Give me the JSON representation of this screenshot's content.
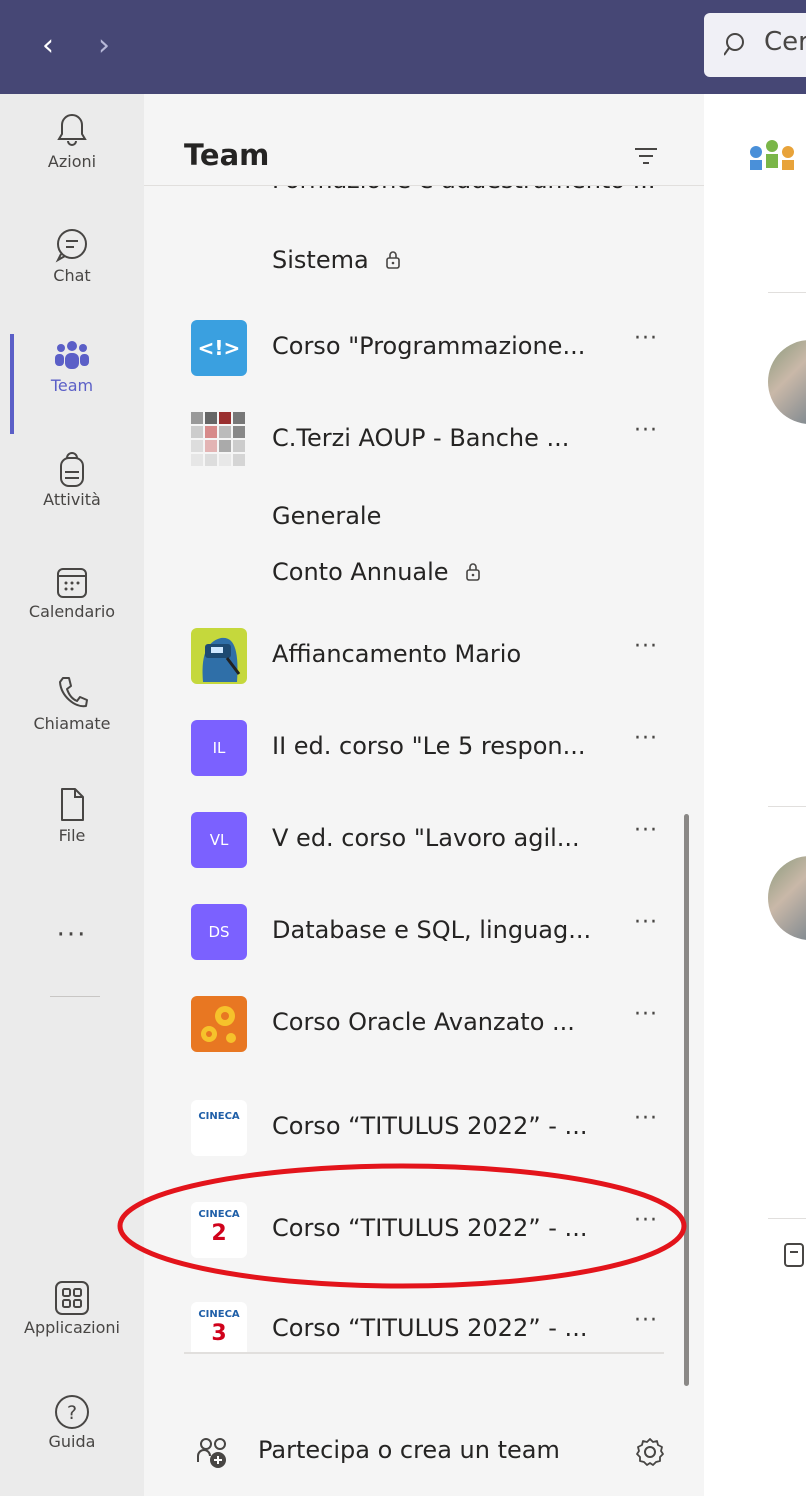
{
  "titlebar": {
    "back_icon": "chevron-left-icon",
    "forward_icon": "chevron-right-icon",
    "search_text": "Cer"
  },
  "rail": {
    "items": [
      {
        "label": "Azioni",
        "icon": "bell-icon"
      },
      {
        "label": "Chat",
        "icon": "chat-icon"
      },
      {
        "label": "Team",
        "icon": "teams-icon",
        "active": true
      },
      {
        "label": "Attività",
        "icon": "backpack-icon"
      },
      {
        "label": "Calendario",
        "icon": "calendar-icon"
      },
      {
        "label": "Chiamate",
        "icon": "phone-icon"
      },
      {
        "label": "File",
        "icon": "file-icon"
      }
    ],
    "more": "···",
    "bottom": [
      {
        "label": "Applicazioni",
        "icon": "apps-icon"
      },
      {
        "label": "Guida",
        "icon": "help-icon"
      }
    ]
  },
  "pane": {
    "title": "Team",
    "cut_off_text": "Formazione e addestramento ...",
    "channels": {
      "sistema": "Sistema",
      "generale": "Generale",
      "conto_annuale": "Conto Annuale"
    },
    "teams": [
      {
        "name": "Corso \"Programmazione...",
        "avatar": "code-logo",
        "color": "#3aa0e0"
      },
      {
        "name": "C.Terzi AOUP - Banche ...",
        "avatar": "mosaic-logo",
        "color": "#b0b0b0"
      },
      {
        "name": "Affiancamento Mario",
        "avatar": "welder-logo",
        "color": "#c5d83c"
      },
      {
        "name": "II ed. corso \"Le 5 respon...",
        "avatar_text": "IL",
        "color": "#7b61ff"
      },
      {
        "name": "V ed. corso \"Lavoro agil...",
        "avatar_text": "VL",
        "color": "#7b61ff"
      },
      {
        "name": "Database e SQL, linguag...",
        "avatar_text": "DS",
        "color": "#7b61ff"
      },
      {
        "name": "Corso Oracle Avanzato ...",
        "avatar": "gears-logo",
        "color": "#e87722"
      },
      {
        "name": "Corso “TITULUS 2022” - ...",
        "avatar": "cineca-logo",
        "avatar_brand": "CINECA",
        "avatar_num": ""
      },
      {
        "name": "Corso “TITULUS 2022” - ...",
        "avatar": "cineca-logo",
        "avatar_brand": "CINECA",
        "avatar_num": "2"
      },
      {
        "name": "Corso “TITULUS 2022” - ...",
        "avatar": "cineca-logo",
        "avatar_brand": "CINECA",
        "avatar_num": "3"
      }
    ],
    "more_label": "···",
    "footer": {
      "join_label": "Partecipa o crea un team"
    }
  },
  "colors": {
    "titlebar": "#464775",
    "accent": "#5b5fc7",
    "annotation": "#e3141b"
  }
}
